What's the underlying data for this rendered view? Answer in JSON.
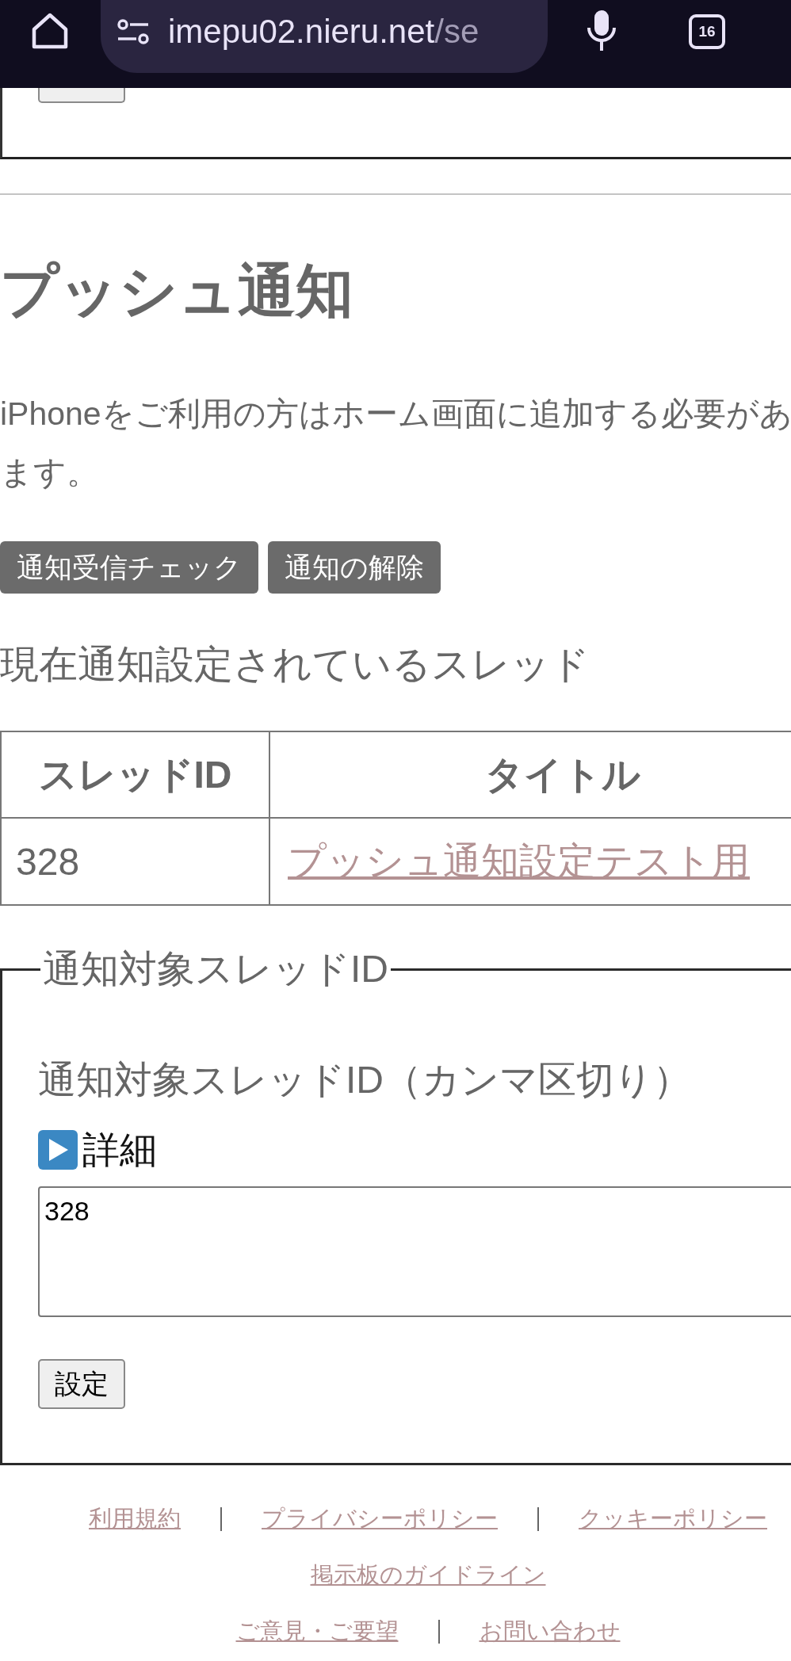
{
  "browser_bar": {
    "url_host": "imepu02.nieru.net",
    "url_path": "/se",
    "tab_count": "16"
  },
  "push_section": {
    "heading": "プッシュ通知",
    "note_lines": [
      "iPhoneをご利用の方はホーム画面に追加する必要があ",
      "ます。"
    ],
    "buttons": [
      {
        "label": "通知受信チェック"
      },
      {
        "label": "通知の解除"
      }
    ],
    "subheading": "現在通知設定されているスレッド",
    "table": {
      "columns": [
        "スレッドID",
        "タイトル"
      ],
      "rows": [
        {
          "thread_id": "328",
          "title": "プッシュ通知設定テスト用"
        }
      ]
    }
  },
  "target_form": {
    "legend": "通知対象スレッドID",
    "label": "通知対象スレッドID（カンマ区切り）",
    "details": {
      "label": "詳細",
      "expanded": false
    },
    "value": "328",
    "submit": "設定"
  },
  "footer": {
    "rows": [
      {
        "links": [
          "利用規約",
          "プライバシーポリシー",
          "クッキーポリシー"
        ]
      },
      {
        "links": [
          "掲示板のガイドライン"
        ]
      },
      {
        "links": [
          "ご意見・ご要望",
          "お問い合わせ"
        ]
      }
    ]
  }
}
